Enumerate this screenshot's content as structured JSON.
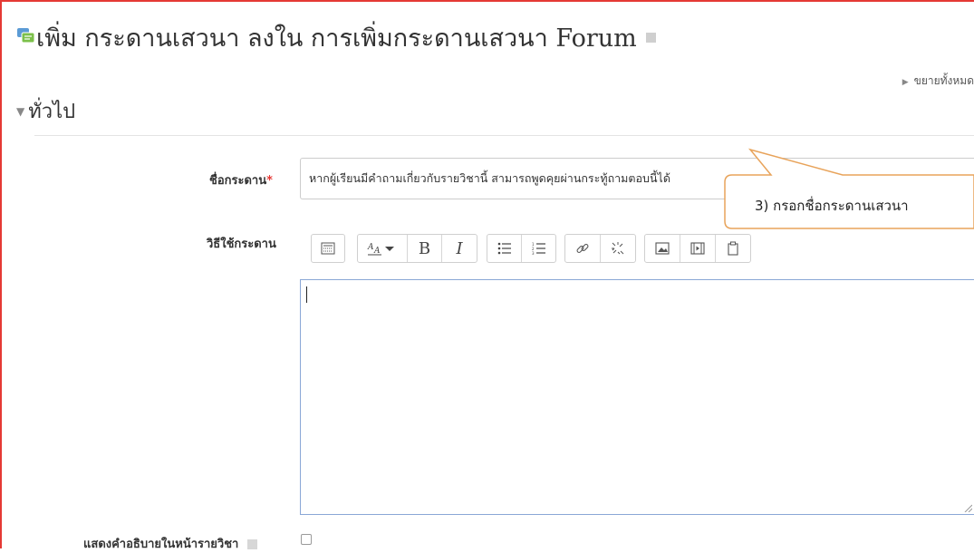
{
  "page": {
    "title": "เพิ่ม กระดานเสวนา ลงใน การเพิ่มกระดานเสวนา Forum",
    "expand_all": "ขยายทั้งหมด"
  },
  "section": {
    "title": "ทั่วไป"
  },
  "form": {
    "forum_name_label": "ชื่อกระดาน",
    "required_mark": "*",
    "forum_name_value": "หากผู้เรียนมีคำถามเกี่ยวกับรายวิชานี้ สามารถพูดคุยผ่านกระทู้ถามตอบนี้ได้",
    "description_label": "วิธีใช้กระดาน",
    "show_description_label": "แสดงคำอธิบายในหน้ารายวิชา",
    "show_description_checked": false
  },
  "editor": {
    "toolbar_icons": [
      [
        "toolbar-toggle-icon"
      ],
      [
        "font-style-icon",
        "bold-icon",
        "italic-icon"
      ],
      [
        "bullet-list-icon",
        "numbered-list-icon"
      ],
      [
        "link-icon",
        "unlink-icon"
      ],
      [
        "image-icon",
        "media-icon",
        "paste-icon"
      ]
    ],
    "bold_glyph": "B",
    "italic_glyph": "I",
    "content": ""
  },
  "callout": {
    "text": "3) กรอกชื่อกระดานเสวนา",
    "border_color": "#e8a35a"
  },
  "colors": {
    "frame_border": "#e53935",
    "required": "#e53935",
    "editor_focus_border": "#8aa7d6"
  }
}
